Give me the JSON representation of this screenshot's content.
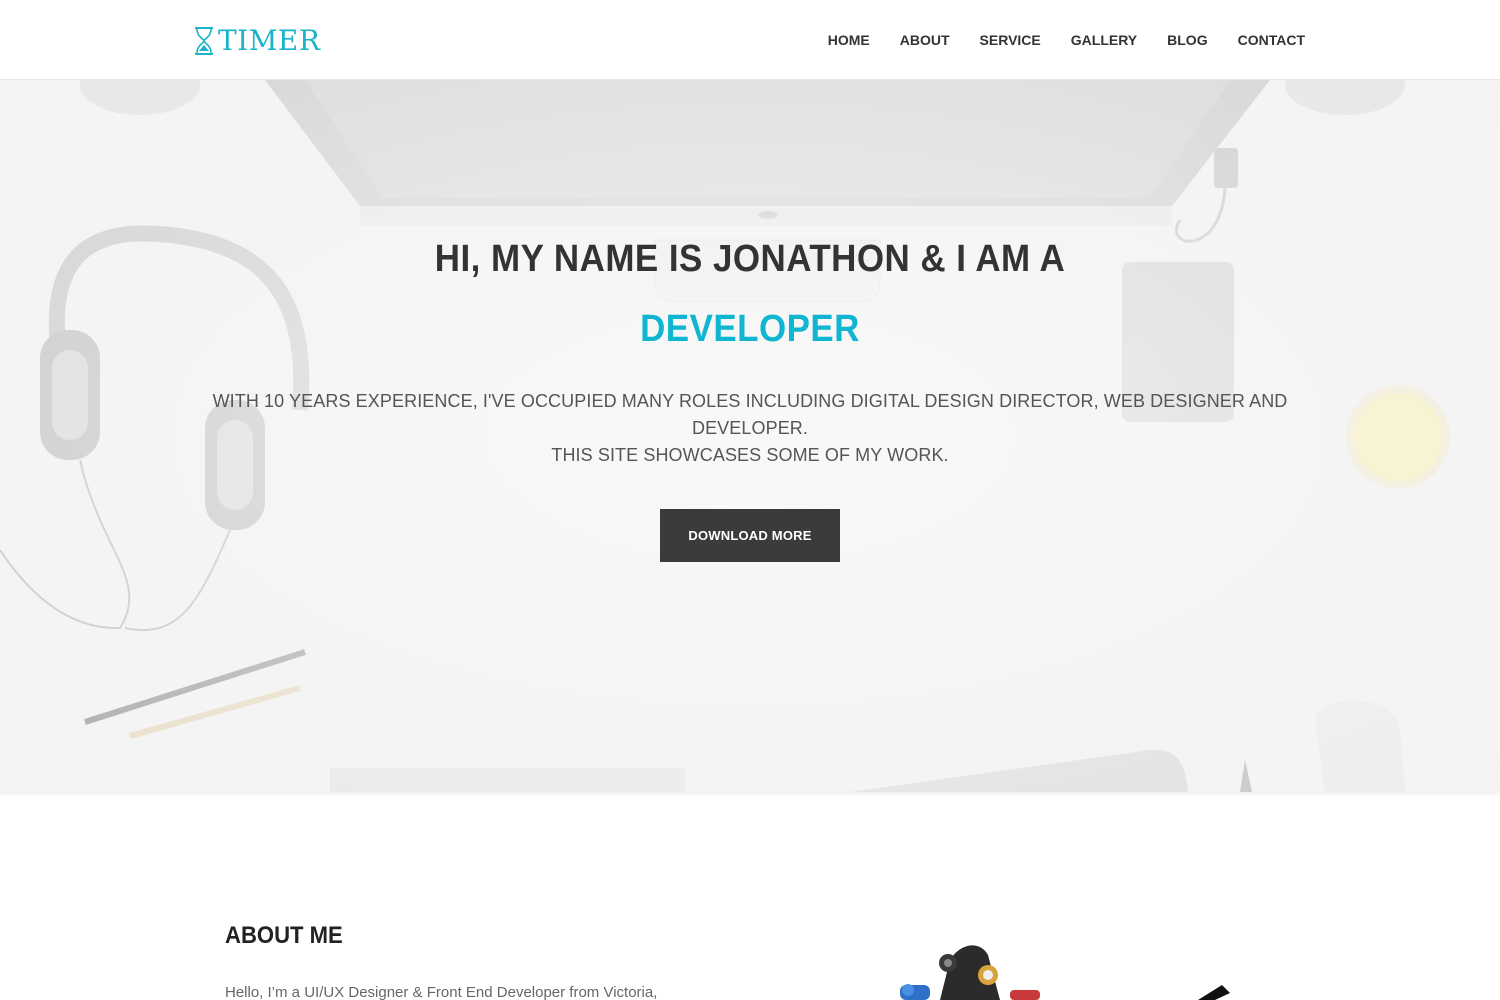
{
  "brand": {
    "name": "TIMER",
    "accent": "#1ab3cc"
  },
  "nav": {
    "items": [
      "HOME",
      "ABOUT",
      "SERVICE",
      "GALLERY",
      "BLOG",
      "CONTACT"
    ]
  },
  "hero": {
    "title": "HI, MY NAME IS JONATHON & I AM A",
    "role": "DEVELOPER",
    "role_color": "#10b6d1",
    "description_line1": "WITH 10 YEARS EXPERIENCE, I'VE OCCUPIED MANY ROLES INCLUDING DIGITAL DESIGN DIRECTOR, WEB DESIGNER AND DEVELOPER.",
    "description_line2": "THIS SITE SHOWCASES SOME OF MY WORK.",
    "button_label": "DOWNLOAD MORE",
    "button_color": "#3b3b3b"
  },
  "about": {
    "title": "ABOUT ME",
    "intro": "Hello, I’m a UI/UX Designer & Front End Developer from Victoria,"
  }
}
